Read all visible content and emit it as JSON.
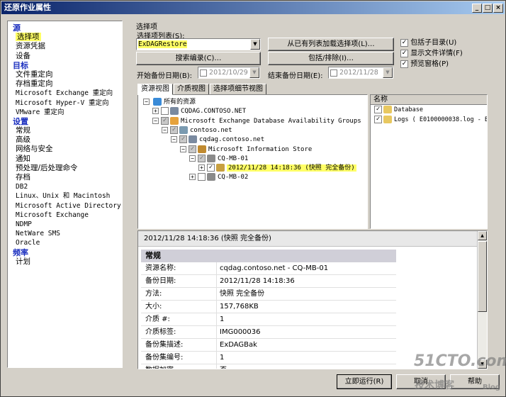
{
  "window": {
    "title": "还原作业属性"
  },
  "nav": {
    "items": [
      {
        "text": "源",
        "type": "cat"
      },
      {
        "text": "选择项",
        "type": "sel"
      },
      {
        "text": "资源凭据",
        "type": "it"
      },
      {
        "text": "设备",
        "type": "it"
      },
      {
        "text": "目标",
        "type": "cat"
      },
      {
        "text": "文件重定向",
        "type": "it"
      },
      {
        "text": "存档重定向",
        "type": "it"
      },
      {
        "text": "Microsoft Exchange 重定向",
        "type": "mono"
      },
      {
        "text": "Microsoft Hyper-V 重定向",
        "type": "mono"
      },
      {
        "text": "VMware 重定向",
        "type": "mono"
      },
      {
        "text": "设置",
        "type": "cat"
      },
      {
        "text": "常规",
        "type": "it"
      },
      {
        "text": "高级",
        "type": "it"
      },
      {
        "text": "网络与安全",
        "type": "it"
      },
      {
        "text": "通知",
        "type": "it"
      },
      {
        "text": "预处理/后处理命令",
        "type": "it"
      },
      {
        "text": "存档",
        "type": "it"
      },
      {
        "text": "DB2",
        "type": "mono"
      },
      {
        "text": "Linux、Unix 和 Macintosh",
        "type": "mono"
      },
      {
        "text": "Microsoft Active Directory",
        "type": "mono"
      },
      {
        "text": "Microsoft Exchange",
        "type": "mono"
      },
      {
        "text": "NDMP",
        "type": "mono"
      },
      {
        "text": "NetWare SMS",
        "type": "mono"
      },
      {
        "text": "Oracle",
        "type": "mono"
      },
      {
        "text": "频率",
        "type": "cat"
      },
      {
        "text": "计划",
        "type": "it"
      }
    ]
  },
  "section": {
    "title": "选择项",
    "list_label": "选择项列表(S):",
    "list_value": "ExDAGRestore"
  },
  "buttons": {
    "load": "从已有列表加载选择项(L)…",
    "search": "搜索编录(C)…",
    "include": "包括/排除(I)…",
    "run": "立即运行(R)",
    "cancel": "取消",
    "help": "帮助"
  },
  "checks": {
    "subdirs": "包括子目录(U)",
    "details": "显示文件详情(F)",
    "preview": "预览窗格(P)"
  },
  "dates": {
    "start_label": "开始备份日期(B):",
    "start_value": "2012/10/29",
    "end_label": "结束备份日期(E):",
    "end_value": "2012/11/28"
  },
  "tabs": [
    "资源视图",
    "介质视图",
    "选择项细节视图"
  ],
  "tree": [
    {
      "text": "所有的资源",
      "level": 0,
      "pm": "-",
      "icon": "globe-icon",
      "color": "#3a8bd8",
      "cb": false
    },
    {
      "text": "CQDAG.CONTOSO.NET",
      "level": 1,
      "pm": "+",
      "icon": "server-icon",
      "color": "#7a8aa0",
      "cb": "empty"
    },
    {
      "text": "Microsoft Exchange Database Availability Groups",
      "level": 1,
      "pm": "-",
      "icon": "exchange-icon",
      "color": "#e6a23c",
      "cb": "gray"
    },
    {
      "text": "contoso.net",
      "level": 2,
      "pm": "-",
      "icon": "domain-icon",
      "color": "#7a9ab0",
      "cb": "gray"
    },
    {
      "text": "cqdag.contoso.net",
      "level": 3,
      "pm": "-",
      "icon": "server-icon",
      "color": "#7a8aa0",
      "cb": "gray"
    },
    {
      "text": "Microsoft Information Store",
      "level": 4,
      "pm": "-",
      "icon": "store-icon",
      "color": "#c08a30",
      "cb": "gray"
    },
    {
      "text": "CQ-MB-01",
      "level": 5,
      "pm": "-",
      "icon": "database-icon",
      "color": "#8a8a8a",
      "cb": "gray"
    },
    {
      "text": "2012/11/28 14:18:36 (快照 完全备份)",
      "level": 6,
      "pm": "+",
      "icon": "snapshot-icon",
      "color": "#c8a040",
      "cb": "checked",
      "selected": true
    },
    {
      "text": "CQ-MB-02",
      "level": 5,
      "pm": "+",
      "icon": "database-icon",
      "color": "#8a8a8a",
      "cb": "empty"
    }
  ],
  "list": {
    "header": "名称",
    "rows": [
      {
        "text": "Database",
        "icon": "folder-icon"
      },
      {
        "text": "Logs ( E0100000038.log - E0",
        "icon": "folder-icon"
      }
    ]
  },
  "detail": {
    "title": "2012/11/28 14:18:36 (快照 完全备份)",
    "heading": "常规",
    "rows": [
      {
        "k": "资源名称:",
        "v": "cqdag.contoso.net - CQ-MB-01"
      },
      {
        "k": "备份日期:",
        "v": "2012/11/28 14:18:36"
      },
      {
        "k": "方法:",
        "v": "快照 完全备份"
      },
      {
        "k": "大小:",
        "v": "157,768KB"
      },
      {
        "k": "介质 #:",
        "v": "1"
      },
      {
        "k": "介质标签:",
        "v": "IMG000036"
      },
      {
        "k": "备份集描述:",
        "v": "ExDAGBak"
      },
      {
        "k": "备份集编号:",
        "v": "1"
      },
      {
        "k": "数据加密:",
        "v": "否"
      }
    ]
  },
  "watermark": {
    "brand": "51CTO.com",
    "sub": "技术博客",
    "blog": "Blog"
  }
}
